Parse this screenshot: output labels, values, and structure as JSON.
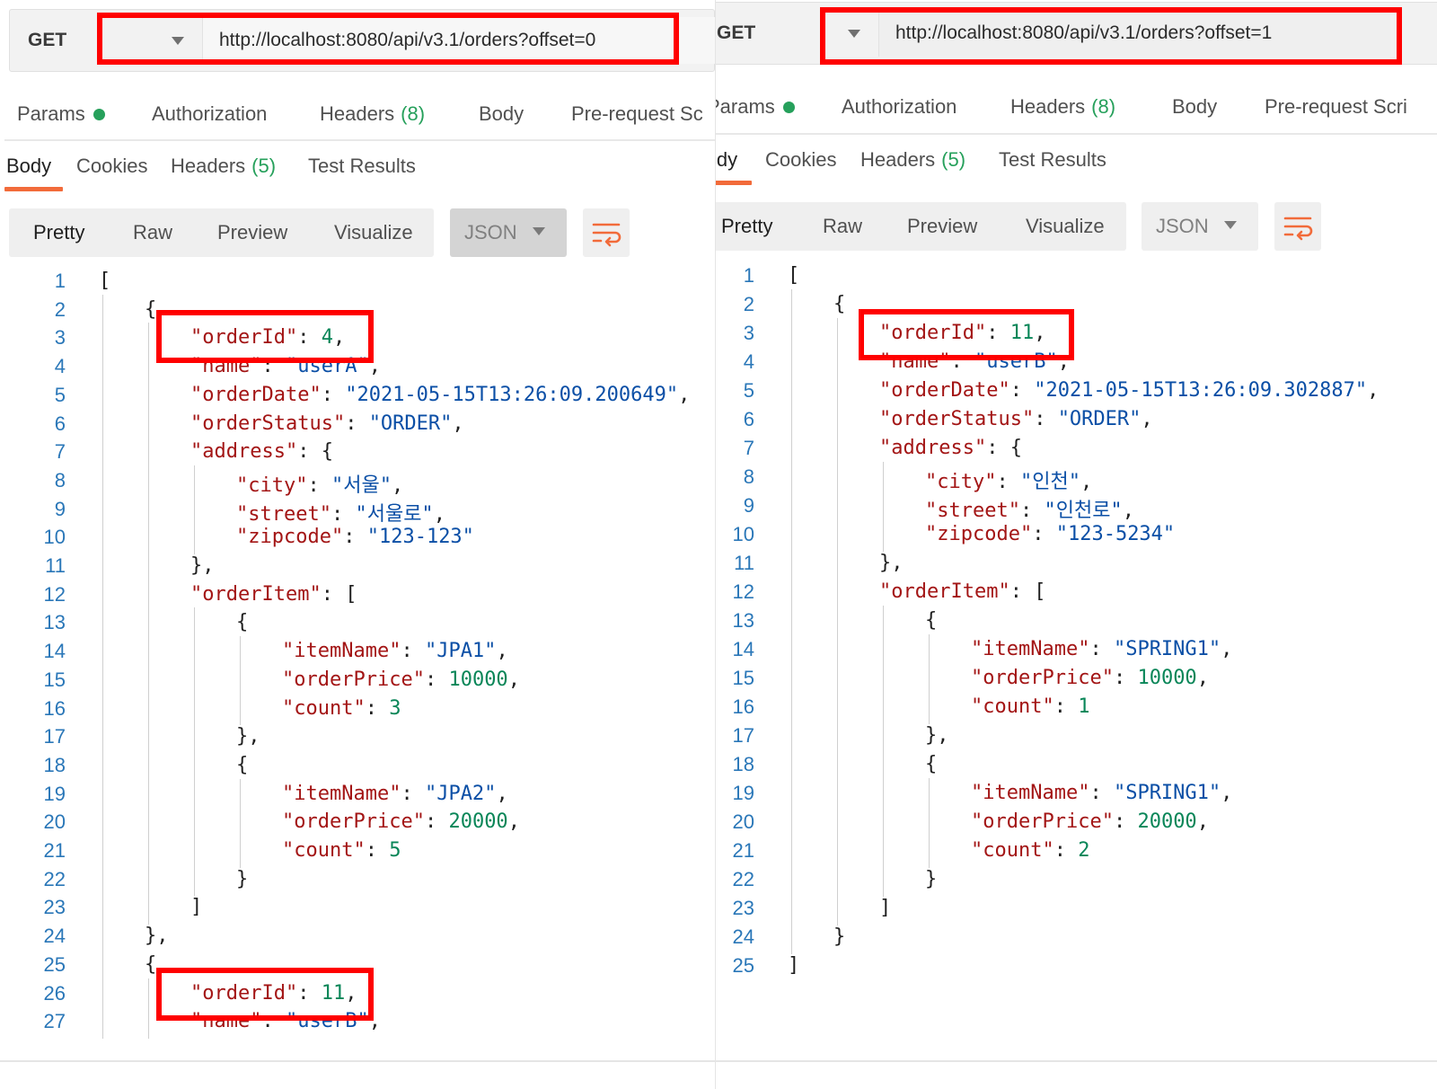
{
  "left": {
    "request": {
      "method": "GET",
      "url": "http://localhost:8080/api/v3.1/orders?offset=0"
    },
    "request_tabs": [
      {
        "label": "Params",
        "dot": true
      },
      {
        "label": "Authorization"
      },
      {
        "label": "Headers",
        "count": "(8)"
      },
      {
        "label": "Body"
      },
      {
        "label": "Pre-request Sc"
      }
    ],
    "response_tabs": [
      {
        "label": "Body",
        "active": true
      },
      {
        "label": "Cookies"
      },
      {
        "label": "Headers",
        "count": "(5)"
      },
      {
        "label": "Test Results"
      }
    ],
    "view_modes": [
      "Pretty",
      "Raw",
      "Preview",
      "Visualize"
    ],
    "format": "JSON",
    "code_lines": [
      {
        "n": "1",
        "t": "["
      },
      {
        "n": "2",
        "t": "{"
      },
      {
        "n": "3",
        "t": "\"orderId\": 4,"
      },
      {
        "n": "4",
        "t": "\"name\": \"userA\","
      },
      {
        "n": "5",
        "t": "\"orderDate\": \"2021-05-15T13:26:09.200649\","
      },
      {
        "n": "6",
        "t": "\"orderStatus\": \"ORDER\","
      },
      {
        "n": "7",
        "t": "\"address\": {"
      },
      {
        "n": "8",
        "t": "\"city\": \"서울\","
      },
      {
        "n": "9",
        "t": "\"street\": \"서울로\","
      },
      {
        "n": "10",
        "t": "\"zipcode\": \"123-123\""
      },
      {
        "n": "11",
        "t": "},"
      },
      {
        "n": "12",
        "t": "\"orderItem\": ["
      },
      {
        "n": "13",
        "t": "{"
      },
      {
        "n": "14",
        "t": "\"itemName\": \"JPA1\","
      },
      {
        "n": "15",
        "t": "\"orderPrice\": 10000,"
      },
      {
        "n": "16",
        "t": "\"count\": 3"
      },
      {
        "n": "17",
        "t": "},"
      },
      {
        "n": "18",
        "t": "{"
      },
      {
        "n": "19",
        "t": "\"itemName\": \"JPA2\","
      },
      {
        "n": "20",
        "t": "\"orderPrice\": 20000,"
      },
      {
        "n": "21",
        "t": "\"count\": 5"
      },
      {
        "n": "22",
        "t": "}"
      },
      {
        "n": "23",
        "t": "]"
      },
      {
        "n": "24",
        "t": "},"
      },
      {
        "n": "25",
        "t": "{"
      },
      {
        "n": "26",
        "t": "\"orderId\": 11,"
      },
      {
        "n": "27",
        "t": "\"name\": \"userB\","
      }
    ]
  },
  "right": {
    "request": {
      "method": "GET",
      "url": "http://localhost:8080/api/v3.1/orders?offset=1"
    },
    "request_tabs": [
      {
        "label": "Params",
        "dot": true
      },
      {
        "label": "Authorization"
      },
      {
        "label": "Headers",
        "count": "(8)"
      },
      {
        "label": "Body"
      },
      {
        "label": "Pre-request Scri"
      }
    ],
    "response_tabs": [
      {
        "label": "Body",
        "active": true
      },
      {
        "label": "Cookies"
      },
      {
        "label": "Headers",
        "count": "(5)"
      },
      {
        "label": "Test Results"
      }
    ],
    "view_modes": [
      "Pretty",
      "Raw",
      "Preview",
      "Visualize"
    ],
    "format": "JSON",
    "code_lines": [
      {
        "n": "1",
        "t": "["
      },
      {
        "n": "2",
        "t": "{"
      },
      {
        "n": "3",
        "t": "\"orderId\": 11,"
      },
      {
        "n": "4",
        "t": "\"name\": \"userB\","
      },
      {
        "n": "5",
        "t": "\"orderDate\": \"2021-05-15T13:26:09.302887\","
      },
      {
        "n": "6",
        "t": "\"orderStatus\": \"ORDER\","
      },
      {
        "n": "7",
        "t": "\"address\": {"
      },
      {
        "n": "8",
        "t": "\"city\": \"인천\","
      },
      {
        "n": "9",
        "t": "\"street\": \"인천로\","
      },
      {
        "n": "10",
        "t": "\"zipcode\": \"123-5234\""
      },
      {
        "n": "11",
        "t": "},"
      },
      {
        "n": "12",
        "t": "\"orderItem\": ["
      },
      {
        "n": "13",
        "t": "{"
      },
      {
        "n": "14",
        "t": "\"itemName\": \"SPRING1\","
      },
      {
        "n": "15",
        "t": "\"orderPrice\": 10000,"
      },
      {
        "n": "16",
        "t": "\"count\": 1"
      },
      {
        "n": "17",
        "t": "},"
      },
      {
        "n": "18",
        "t": "{"
      },
      {
        "n": "19",
        "t": "\"itemName\": \"SPRING1\","
      },
      {
        "n": "20",
        "t": "\"orderPrice\": 20000,"
      },
      {
        "n": "21",
        "t": "\"count\": 2"
      },
      {
        "n": "22",
        "t": "}"
      },
      {
        "n": "23",
        "t": "]"
      },
      {
        "n": "24",
        "t": "}"
      },
      {
        "n": "25",
        "t": "]"
      }
    ]
  },
  "colors": {
    "highlight": "#ff0000",
    "accent": "#f26b3a",
    "success": "#26a05b",
    "key": "#a31515",
    "string": "#0b4fa6",
    "number": "#098658",
    "line_number": "#2a77b8"
  },
  "icons": {
    "method_dropdown": "chevron-down-icon",
    "wrap": "wrap-lines-icon",
    "params_status": "green-dot"
  }
}
